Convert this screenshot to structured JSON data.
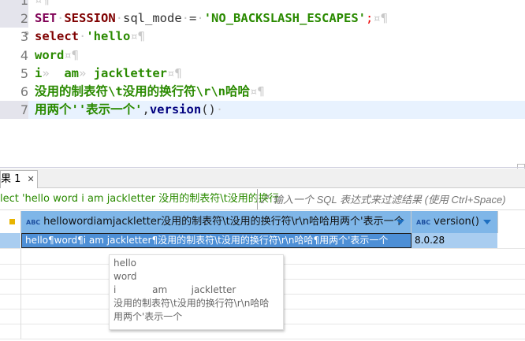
{
  "editor": {
    "lines": [
      {
        "n": "1",
        "parts": [
          {
            "c": "ws",
            "t": "¤¶"
          }
        ]
      },
      {
        "n": "2",
        "parts": [
          {
            "c": "kw",
            "t": "SET"
          },
          {
            "c": "ws",
            "t": "·"
          },
          {
            "c": "kw2",
            "t": "SESSION"
          },
          {
            "c": "ws",
            "t": "·"
          },
          {
            "c": "pl",
            "t": "sql_mode"
          },
          {
            "c": "ws",
            "t": "·"
          },
          {
            "c": "pl",
            "t": "="
          },
          {
            "c": "ws",
            "t": "·"
          },
          {
            "c": "str",
            "t": "'NO_BACKSLASH_ESCAPES'"
          },
          {
            "c": "red",
            "t": ";"
          },
          {
            "c": "ws",
            "t": "¤¶"
          }
        ]
      },
      {
        "n": "3",
        "parts": [
          {
            "c": "kw2",
            "t": "select"
          },
          {
            "c": "ws",
            "t": "·"
          },
          {
            "c": "str",
            "t": "'hello"
          },
          {
            "c": "ws",
            "t": "¤¶"
          }
        ]
      },
      {
        "n": "4",
        "parts": [
          {
            "c": "str",
            "t": "word"
          },
          {
            "c": "ws",
            "t": "¤¶"
          }
        ]
      },
      {
        "n": "5",
        "parts": [
          {
            "c": "str",
            "t": "i"
          },
          {
            "c": "ws",
            "t": "»  "
          },
          {
            "c": "str",
            "t": "am"
          },
          {
            "c": "ws",
            "t": "» "
          },
          {
            "c": "str",
            "t": "jackletter"
          },
          {
            "c": "ws",
            "t": "¤¶"
          }
        ]
      },
      {
        "n": "6",
        "parts": [
          {
            "c": "str",
            "t": "没用的制表符\\t没用的换行符\\r\\n哈哈"
          },
          {
            "c": "ws",
            "t": "¤¶"
          }
        ]
      },
      {
        "n": "7",
        "parts": [
          {
            "c": "str",
            "t": "用两个''表示一个'"
          },
          {
            "c": "pl",
            "t": ","
          },
          {
            "c": "fn",
            "t": "version"
          },
          {
            "c": "pl",
            "t": "()"
          },
          {
            "c": "ws",
            "t": "·"
          }
        ]
      }
    ]
  },
  "results": {
    "tab_label": "果 1",
    "tab_close": "✕",
    "query_text": "lect 'hello word i am jackletter 没用的制表符\\t没用的换行",
    "filter_placeholder": "输入一个 SQL 表达式来过滤结果 (使用 Ctrl+Space)",
    "columns": [
      {
        "type": "ABC",
        "label": "hellowordiamjackletter没用的制表符\\t没用的换行符\\r\\n哈哈用两个'表示一个"
      },
      {
        "type": "ABC",
        "label": "version()"
      }
    ],
    "rows": [
      [
        "hello¶word¶i am jackletter¶没用的制表符\\t没用的换行符\\r\\n哈哈¶用两个'表示一个",
        "8.0.28"
      ]
    ],
    "tooltip": "hello\nword\ni            am        jackletter\n没用的制表符\\t没用的换行符\\r\\n哈哈\n用两个'表示一个"
  },
  "colors": {
    "header": "#7fb6e8",
    "selected_row": "#a9cdf0",
    "string": "#2a8a00",
    "keyword": "#7f0055"
  }
}
